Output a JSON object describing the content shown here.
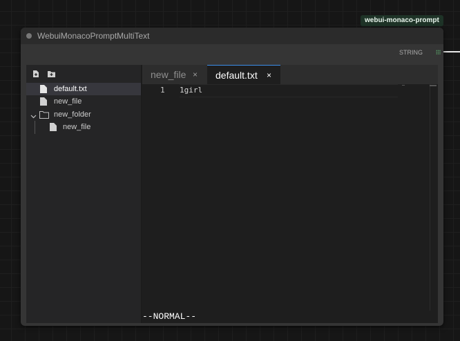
{
  "node_badge": "webui-monaco-prompt",
  "node": {
    "title": "WebuiMonacoPromptMultiText",
    "output": {
      "label": "STRING",
      "color": "#6ddc84"
    }
  },
  "sidebar": {
    "toolbar": [
      {
        "icon": "new-file-icon"
      },
      {
        "icon": "new-folder-icon"
      }
    ],
    "tree": [
      {
        "label": "default.txt",
        "type": "file",
        "active": true
      },
      {
        "label": "new_file",
        "type": "file"
      },
      {
        "label": "new_folder",
        "type": "folder",
        "expanded": true
      },
      {
        "label": "new_file",
        "type": "file",
        "parent": "new_folder"
      }
    ]
  },
  "editor": {
    "tabs": [
      {
        "label": "new_file",
        "close": "×"
      },
      {
        "label": "default.txt",
        "close": "×",
        "active": true
      }
    ],
    "lines": [
      {
        "number": "1",
        "text": "1girl"
      }
    ],
    "mode": "--NORMAL--",
    "accent": "#3b8eea"
  }
}
